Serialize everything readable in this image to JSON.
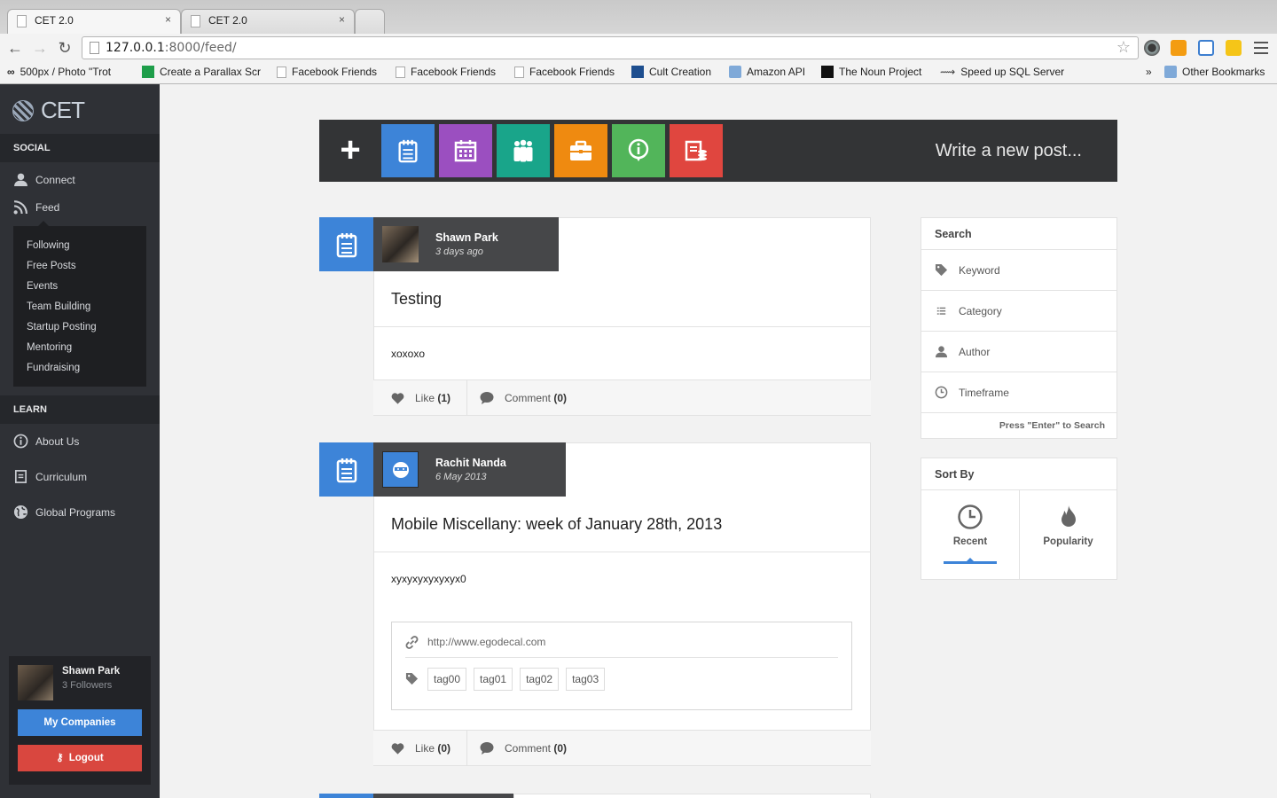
{
  "browser": {
    "tabs": [
      {
        "title": "CET 2.0",
        "close": "×"
      },
      {
        "title": "CET 2.0",
        "close": "×"
      }
    ],
    "url_host": "127.0.0.1",
    "url_rest": ":8000/feed/",
    "bookmarks": [
      {
        "label": "500px / Photo \"Trot",
        "icon": "infinity-icon"
      },
      {
        "label": "Create a Parallax Scr",
        "icon": "green-plus-icon"
      },
      {
        "label": "Facebook Friends",
        "icon": "page-icon"
      },
      {
        "label": "Facebook Friends",
        "icon": "page-icon"
      },
      {
        "label": "Facebook Friends",
        "icon": "page-icon"
      },
      {
        "label": "Cult Creation",
        "icon": "s-logo-icon"
      },
      {
        "label": "Amazon API",
        "icon": "folder-icon"
      },
      {
        "label": "The Noun Project",
        "icon": "black-square-icon"
      },
      {
        "label": "Speed up SQL Server",
        "icon": "sql-icon"
      }
    ],
    "overflow": "»",
    "other_bookmarks": "Other Bookmarks"
  },
  "sidebar": {
    "logo": "CET",
    "social_header": "SOCIAL",
    "social_items": [
      {
        "label": "Connect",
        "icon": "user-icon"
      },
      {
        "label": "Feed",
        "icon": "rss-icon"
      }
    ],
    "feed_submenu": [
      "Following",
      "Free Posts",
      "Events",
      "Team Building",
      "Startup Posting",
      "Mentoring",
      "Fundraising"
    ],
    "learn_header": "LEARN",
    "learn_items": [
      {
        "label": "About Us",
        "icon": "info-icon"
      },
      {
        "label": "Curriculum",
        "icon": "document-icon"
      },
      {
        "label": "Global Programs",
        "icon": "globe-icon"
      }
    ],
    "profile": {
      "name": "Shawn Park",
      "followers": "3 Followers",
      "companies_button": "My Companies",
      "logout_button": "Logout"
    }
  },
  "composer": {
    "plus": "+",
    "placeholder": "Write a new post...",
    "types": [
      {
        "icon": "notepad-icon",
        "color": "#3d84d8"
      },
      {
        "icon": "calendar-icon",
        "color": "#9b4fc0"
      },
      {
        "icon": "team-icon",
        "color": "#19a58a"
      },
      {
        "icon": "briefcase-icon",
        "color": "#ef8a10"
      },
      {
        "icon": "info-pin-icon",
        "color": "#52b55a"
      },
      {
        "icon": "money-icon",
        "color": "#e0463f"
      }
    ]
  },
  "posts": [
    {
      "author": "Shawn Park",
      "date": "3 days ago",
      "title": "Testing",
      "body": "xoxoxo",
      "like_label": "Like",
      "like_count": "(1)",
      "comment_label": "Comment",
      "comment_count": "(0)"
    },
    {
      "author": "Rachit Nanda",
      "date": "6 May 2013",
      "title": "Mobile Miscellany: week of January 28th, 2013",
      "body": "xyxyxyxyxyxyx0",
      "link": "http://www.egodecal.com",
      "tags": [
        "tag00",
        "tag01",
        "tag02",
        "tag03"
      ],
      "like_label": "Like",
      "like_count": "(0)",
      "comment_label": "Comment",
      "comment_count": "(0)"
    }
  ],
  "search": {
    "header": "Search",
    "fields": [
      {
        "label": "Keyword",
        "icon": "tag-icon"
      },
      {
        "label": "Category",
        "icon": "list-icon"
      },
      {
        "label": "Author",
        "icon": "user-icon"
      },
      {
        "label": "Timeframe",
        "icon": "clock-icon"
      }
    ],
    "hint": "Press \"Enter\" to Search"
  },
  "sort": {
    "header": "Sort By",
    "options": [
      {
        "label": "Recent",
        "icon": "clock-icon",
        "active": true
      },
      {
        "label": "Popularity",
        "icon": "flame-icon",
        "active": false
      }
    ]
  }
}
